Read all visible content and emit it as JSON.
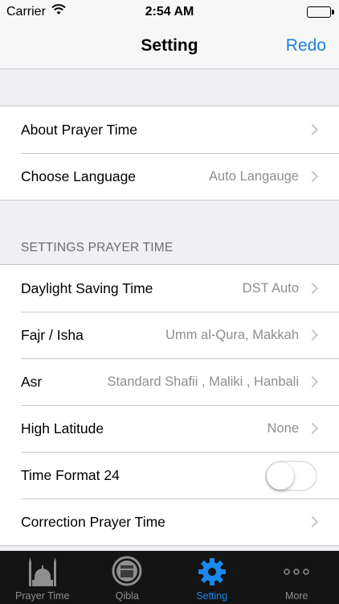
{
  "status_bar": {
    "carrier": "Carrier",
    "time": "2:54 AM"
  },
  "nav": {
    "title": "Setting",
    "right_button": "Redo"
  },
  "general": {
    "items": [
      {
        "label": "About Prayer Time",
        "detail": ""
      },
      {
        "label": "Choose Language",
        "detail": "Auto Langauge"
      }
    ]
  },
  "prayer_settings": {
    "header": "SETTINGS PRAYER TIME",
    "items": [
      {
        "label": "Daylight Saving Time",
        "detail": "DST Auto"
      },
      {
        "label": "Fajr / Isha",
        "detail": "Umm al-Qura, Makkah"
      },
      {
        "label": "Asr",
        "detail": "Standard Shafii , Maliki , Hanbali"
      },
      {
        "label": "High Latitude",
        "detail": "None"
      },
      {
        "label": "Time Format 24",
        "toggle": false
      },
      {
        "label": "Correction Prayer Time",
        "detail": ""
      }
    ]
  },
  "tab_bar": {
    "tabs": [
      {
        "label": "Prayer Time",
        "icon": "mosque-icon"
      },
      {
        "label": "Qibla",
        "icon": "kaaba-icon"
      },
      {
        "label": "Setting",
        "icon": "gear-icon",
        "active": true
      },
      {
        "label": "More",
        "icon": "more-dots-icon"
      }
    ]
  },
  "colors": {
    "accent": "#1a82e0",
    "tab_active": "#1b88f0",
    "tab_bar_bg": "#141414",
    "background": "#efeff4"
  }
}
